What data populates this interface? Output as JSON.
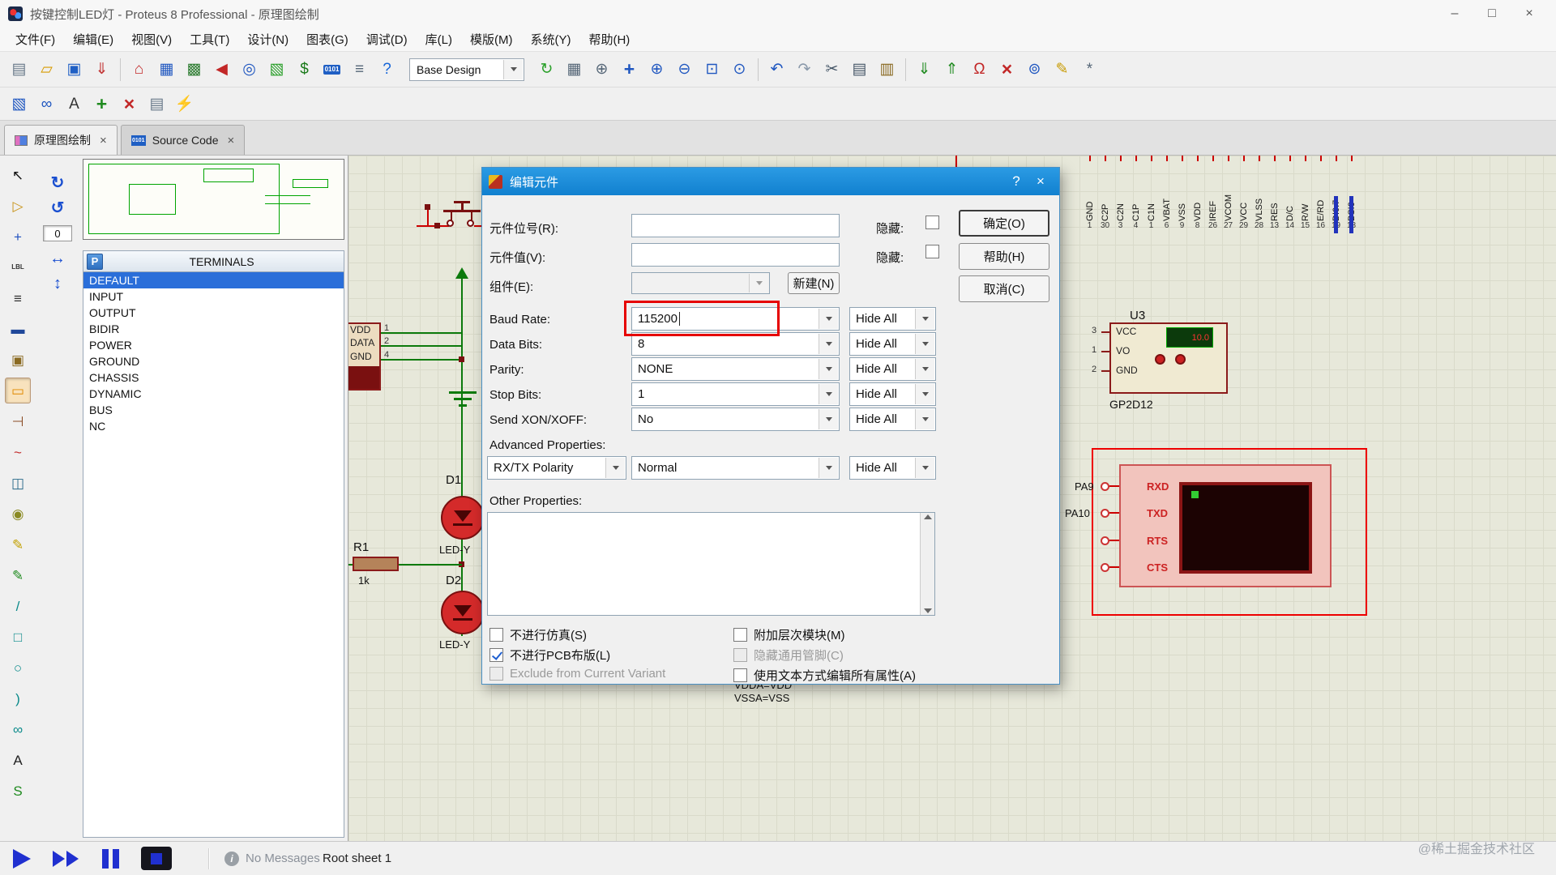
{
  "window": {
    "title": "按键控制LED灯 - Proteus 8 Professional - 原理图绘制",
    "minimize": "–",
    "maximize": "□",
    "close": "×"
  },
  "menu": [
    "文件(F)",
    "编辑(E)",
    "视图(V)",
    "工具(T)",
    "设计(N)",
    "图表(G)",
    "调试(D)",
    "库(L)",
    "模版(M)",
    "系统(Y)",
    "帮助(H)"
  ],
  "toolbar1": {
    "file_icons": [
      {
        "name": "new-file-icon",
        "glyph": "▤",
        "color": "#667788"
      },
      {
        "name": "open-folder-icon",
        "glyph": "▱",
        "color": "#d79a00"
      },
      {
        "name": "save-icon",
        "glyph": "▣",
        "color": "#1f5fc4"
      },
      {
        "name": "import-icon",
        "glyph": "⇓",
        "color": "#c23333"
      }
    ],
    "app_icons": [
      {
        "name": "home-icon",
        "glyph": "⌂",
        "color": "#c22727"
      },
      {
        "name": "schematic-capture-icon",
        "glyph": "▦",
        "color": "#2057c0"
      },
      {
        "name": "pcb-layout-icon",
        "glyph": "▩",
        "color": "#2e7d32"
      },
      {
        "name": "simulate-icon",
        "glyph": "◀",
        "color": "#c22727"
      },
      {
        "name": "view-design-icon",
        "glyph": "◎",
        "color": "#2057c0"
      },
      {
        "name": "3d-view-icon",
        "glyph": "▧",
        "color": "#2aa02a"
      },
      {
        "name": "bom-icon",
        "glyph": "$",
        "color": "#1a7a1a"
      },
      {
        "name": "source-code-icon",
        "glyph": "0101",
        "color": "#ffffff"
      },
      {
        "name": "design-notes-icon",
        "glyph": "≡",
        "color": "#556677"
      },
      {
        "name": "help-icon",
        "glyph": "?",
        "color": "#1565d8"
      }
    ],
    "design_combo": "Base Design",
    "view_icons": [
      {
        "name": "redraw-icon",
        "glyph": "↻",
        "color": "#2aa02a"
      },
      {
        "name": "grid-toggle-icon",
        "glyph": "▦",
        "color": "#556677"
      },
      {
        "name": "origin-icon",
        "glyph": "⊕",
        "color": "#556677"
      },
      {
        "name": "pan-icon",
        "glyph": "+",
        "color": "#2057c0"
      },
      {
        "name": "zoom-in-icon",
        "glyph": "⊕",
        "color": "#2057c0"
      },
      {
        "name": "zoom-out-icon",
        "glyph": "⊖",
        "color": "#2057c0"
      },
      {
        "name": "zoom-area-icon",
        "glyph": "⊡",
        "color": "#2057c0"
      },
      {
        "name": "zoom-extents-icon",
        "glyph": "⊙",
        "color": "#2057c0"
      }
    ],
    "edit_icons": [
      {
        "name": "undo-icon",
        "glyph": "↶",
        "color": "#2057c0"
      },
      {
        "name": "redo-icon",
        "glyph": "↷",
        "color": "#8a99aa"
      },
      {
        "name": "cut-icon",
        "glyph": "✂",
        "color": "#445566"
      },
      {
        "name": "copy-icon",
        "glyph": "▤",
        "color": "#445566"
      },
      {
        "name": "paste-icon",
        "glyph": "▥",
        "color": "#8a6a22"
      }
    ],
    "block_icons": [
      {
        "name": "block-copy-icon",
        "glyph": "⇓",
        "color": "#1f8a1f"
      },
      {
        "name": "block-move-icon",
        "glyph": "⇑",
        "color": "#1f8a1f"
      },
      {
        "name": "erc-report-icon",
        "glyph": "Ω",
        "color": "#c22727"
      },
      {
        "name": "block-delete-icon",
        "glyph": "×",
        "color": "#c22727"
      },
      {
        "name": "search-icon",
        "glyph": "⊚",
        "color": "#2057c0"
      },
      {
        "name": "property-edit-icon",
        "glyph": "✎",
        "color": "#c79a00"
      },
      {
        "name": "design-config-icon",
        "glyph": "*",
        "color": "#556677"
      }
    ]
  },
  "toolbar2": {
    "icons": [
      {
        "name": "template-icon",
        "glyph": "▧",
        "color": "#2057c0"
      },
      {
        "name": "binoculars-icon",
        "glyph": "∞",
        "color": "#2057c0"
      },
      {
        "name": "edit-text-icon",
        "glyph": "A",
        "color": "#333333"
      },
      {
        "name": "add-sheet-icon",
        "glyph": "+",
        "color": "#1f8a1f"
      },
      {
        "name": "remove-sheet-icon",
        "glyph": "×",
        "color": "#c22727"
      },
      {
        "name": "goto-sheet-icon",
        "glyph": "▤",
        "color": "#667788"
      },
      {
        "name": "electrical-rule-icon",
        "glyph": "⚡",
        "color": "#d79a00"
      }
    ]
  },
  "tabs": {
    "schematic": "原理图绘制",
    "source": "Source Code",
    "source_icon": "0101",
    "close_glyph": "×"
  },
  "rotate": {
    "cw": "↻",
    "ccw": "↺",
    "angle": "0",
    "mirror_h": "↔",
    "mirror_v": "↕"
  },
  "terminals": {
    "pick": "P",
    "title": "TERMINALS",
    "items": [
      "DEFAULT",
      "INPUT",
      "OUTPUT",
      "BIDIR",
      "POWER",
      "GROUND",
      "CHASSIS",
      "DYNAMIC",
      "BUS",
      "NC"
    ]
  },
  "palette": [
    {
      "name": "selection-mode-icon",
      "glyph": "↖",
      "color": "#111111"
    },
    {
      "name": "component-mode-icon",
      "glyph": "▷",
      "color": "#c9941a"
    },
    {
      "name": "junction-mode-icon",
      "glyph": "+",
      "color": "#2050c0"
    },
    {
      "name": "wire-label-mode-icon",
      "glyph": "LBL",
      "color": "#333333"
    },
    {
      "name": "text-script-mode-icon",
      "glyph": "≡",
      "color": "#333333"
    },
    {
      "name": "bus-mode-icon",
      "glyph": "▬",
      "color": "#20489a"
    },
    {
      "name": "subcircuit-mode-icon",
      "glyph": "▣",
      "color": "#8a6a22"
    },
    {
      "name": "terminals-mode-icon",
      "glyph": "▭",
      "color": "#e08a00"
    },
    {
      "name": "device-pins-mode-icon",
      "glyph": "⊣",
      "color": "#8a4a22"
    },
    {
      "name": "graph-mode-icon",
      "glyph": "~",
      "color": "#c22727"
    },
    {
      "name": "tape-recorder-mode-icon",
      "glyph": "◫",
      "color": "#2a6a8a"
    },
    {
      "name": "generator-mode-icon",
      "glyph": "◉",
      "color": "#8a8a22"
    },
    {
      "name": "voltage-probe-mode-icon",
      "glyph": "✎",
      "color": "#c2a000"
    },
    {
      "name": "current-probe-mode-icon",
      "glyph": "✎",
      "color": "#1f8a1f"
    },
    {
      "name": "line-2d-icon",
      "glyph": "/",
      "color": "#0a8a8a"
    },
    {
      "name": "box-2d-icon",
      "glyph": "□",
      "color": "#0a8a8a"
    },
    {
      "name": "circle-2d-icon",
      "glyph": "○",
      "color": "#0a8a8a"
    },
    {
      "name": "arc-2d-icon",
      "glyph": ")",
      "color": "#0a8a8a"
    },
    {
      "name": "path-2d-icon",
      "glyph": "∞",
      "color": "#0a8a8a"
    },
    {
      "name": "text-2d-icon",
      "glyph": "A",
      "color": "#222222"
    },
    {
      "name": "symbol-2d-icon",
      "glyph": "S",
      "color": "#1f8a1f"
    }
  ],
  "canvas": {
    "d1": {
      "ref": "D1",
      "value": "LED-Y"
    },
    "d2": {
      "ref": "D2",
      "value": "LED-Y"
    },
    "r1": {
      "ref": "R1",
      "value": "1k"
    },
    "u3": {
      "ref": "U3",
      "part": "GP2D12",
      "display": "10.0",
      "pins": [
        {
          "num": "3",
          "name": "VCC"
        },
        {
          "num": "1",
          "name": "VO"
        },
        {
          "num": "2",
          "name": "GND"
        }
      ]
    },
    "sensor": {
      "pins": [
        {
          "num": "1",
          "name": "VDD"
        },
        {
          "num": "2",
          "name": "DATA"
        },
        {
          "num": "4",
          "name": "GND"
        }
      ]
    },
    "serial": {
      "pins": [
        "RXD",
        "TXD",
        "RTS",
        "CTS"
      ],
      "nets": [
        "PA9",
        "PA10"
      ]
    },
    "oled_pins": [
      {
        "num": "1",
        "name": "GND"
      },
      {
        "num": "30",
        "name": "C2P"
      },
      {
        "num": "3",
        "name": "C2N"
      },
      {
        "num": "4",
        "name": "C1P"
      },
      {
        "num": "1",
        "name": "C1N"
      },
      {
        "num": "6",
        "name": "VBAT"
      },
      {
        "num": "9",
        "name": "VSS"
      },
      {
        "num": "8",
        "name": "VDD"
      },
      {
        "num": "26",
        "name": "IREF"
      },
      {
        "num": "27",
        "name": "VCOM"
      },
      {
        "num": "29",
        "name": "VCC"
      },
      {
        "num": "28",
        "name": "VLSS"
      },
      {
        "num": "13",
        "name": "RES"
      },
      {
        "num": "14",
        "name": "D/C"
      },
      {
        "num": "15",
        "name": "R/W"
      },
      {
        "num": "16",
        "name": "E/RD"
      },
      {
        "num": "19",
        "name": "DI0.7"
      },
      {
        "num": "18",
        "name": "BSI0"
      }
    ],
    "notes": [
      "VDDA=VDD",
      "VSSA=VSS"
    ]
  },
  "dialog": {
    "title": "编辑元件",
    "help_glyph": "?",
    "close_glyph": "×",
    "ref_label": "元件位号(R):",
    "value_label": "元件值(V):",
    "element_label": "组件(E):",
    "hidden_label": "隐藏:",
    "new_button": "新建(N)",
    "hide_all": "Hide All",
    "rows": [
      {
        "label": "Baud Rate:",
        "value": "115200"
      },
      {
        "label": "Data Bits:",
        "value": "8"
      },
      {
        "label": "Parity:",
        "value": "NONE"
      },
      {
        "label": "Stop Bits:",
        "value": "1"
      },
      {
        "label": "Send XON/XOFF:",
        "value": "No"
      }
    ],
    "advanced_label": "Advanced Properties:",
    "advanced_combo": "RX/TX Polarity",
    "advanced_value": "Normal",
    "other_label": "Other Properties:",
    "checks_left": [
      {
        "label": "不进行仿真(S)"
      },
      {
        "label": "不进行PCB布版(L)"
      },
      {
        "label": "Exclude from Current Variant"
      }
    ],
    "checks_right": [
      {
        "label": "附加层次模块(M)"
      },
      {
        "label": "隐藏通用管脚(C)"
      },
      {
        "label": "使用文本方式编辑所有属性(A)"
      }
    ],
    "ok": "确定(O)",
    "help": "帮助(H)",
    "cancel": "取消(C)"
  },
  "statusbar": {
    "message": "No Messages",
    "sheet": "Root sheet 1"
  },
  "watermark": "@稀土掘金技术社区"
}
